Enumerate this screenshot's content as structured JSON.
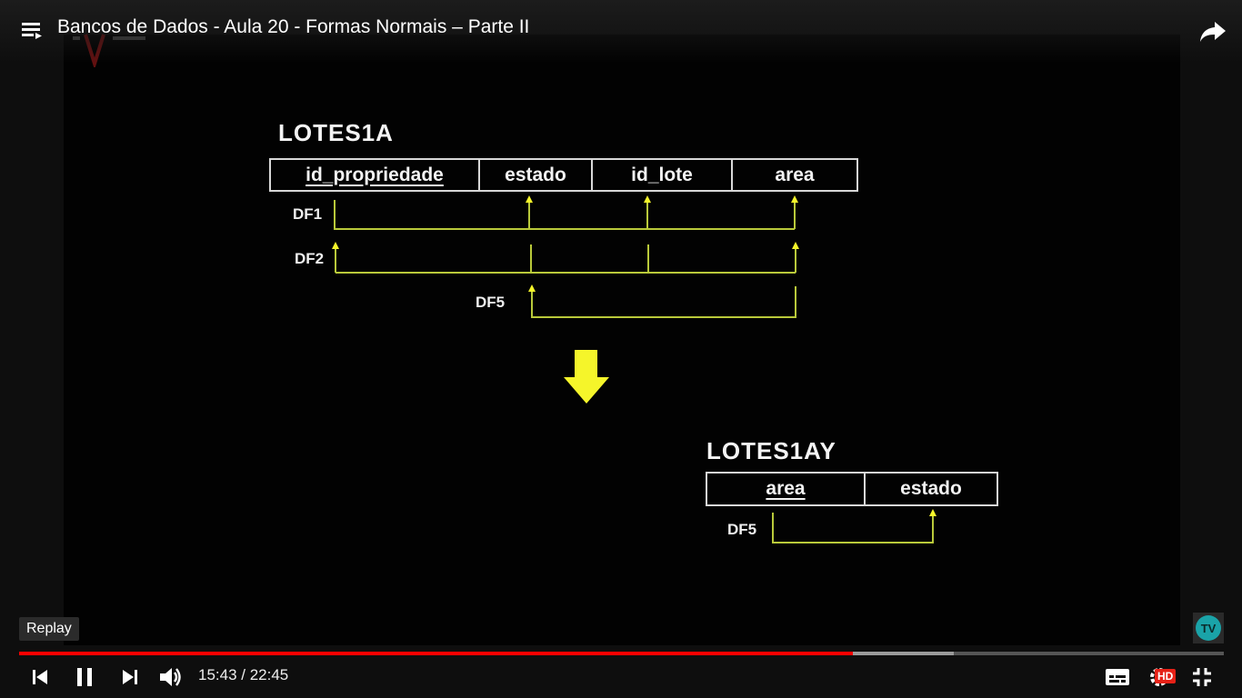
{
  "player": {
    "title": "Bancos de Dados - Aula 20 - Formas Normais – Parte II",
    "current_time": "15:43",
    "duration": "22:45",
    "time_separator": " / ",
    "progress_fraction": 0.692,
    "buffered_fraction": 0.776,
    "tooltip": "Replay",
    "hd_badge": "HD",
    "accent_color": "#ff0000"
  },
  "slide": {
    "table1": {
      "name": "LOTES1A",
      "columns": [
        {
          "label": "id_propriedade",
          "key": true
        },
        {
          "label": "estado",
          "key": false
        },
        {
          "label": "id_lote",
          "key": false
        },
        {
          "label": "area",
          "key": false
        }
      ],
      "dependencies": [
        "DF1",
        "DF2",
        "DF5"
      ]
    },
    "table2": {
      "name": "LOTES1AY",
      "columns": [
        {
          "label": "area",
          "key": true
        },
        {
          "label": "estado",
          "key": false
        }
      ],
      "dependencies": [
        "DF5"
      ]
    },
    "arrow_color": "#f5f52a",
    "line_color": "#b9c93a"
  },
  "icons": {
    "menu": "playlist-icon",
    "share": "share-icon",
    "previous": "skip-previous-icon",
    "pause": "pause-icon",
    "next": "skip-next-icon",
    "volume": "volume-icon",
    "subtitles": "subtitles-icon",
    "settings": "settings-gear-icon",
    "exit_fullscreen": "exit-fullscreen-icon",
    "channel_logo": "tv-logo-icon"
  }
}
